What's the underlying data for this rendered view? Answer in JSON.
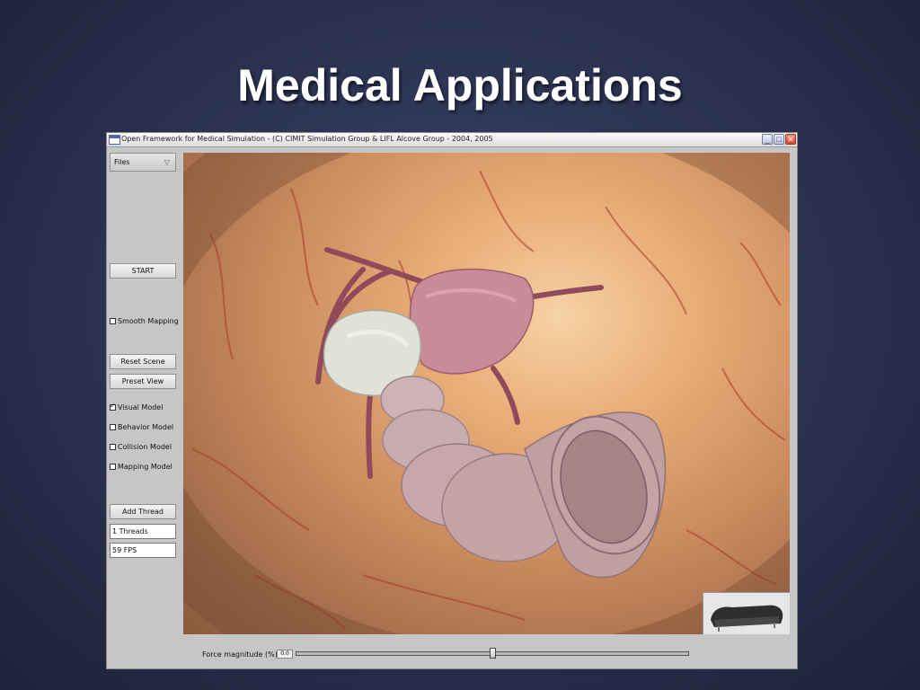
{
  "slide": {
    "title": "Medical Applications"
  },
  "window": {
    "title": "Open Framework for Medical Simulation - (C) CIMIT Simulation Group & LIFL Alcove Group - 2004, 2005",
    "controls": {
      "minimize": "_",
      "maximize": "□",
      "close": "✕"
    }
  },
  "sidebar": {
    "files_label": "Files",
    "start_label": "START",
    "smooth_mapping_label": "Smooth Mapping",
    "smooth_mapping_checked": false,
    "reset_scene_label": "Reset Scene",
    "preset_view_label": "Preset View",
    "visual_model_label": "Visual Model",
    "visual_model_checked": true,
    "behavior_model_label": "Behavior Model",
    "behavior_model_checked": false,
    "collision_model_label": "Collision Model",
    "collision_model_checked": false,
    "mapping_model_label": "Mapping Model",
    "mapping_model_checked": false,
    "add_thread_label": "Add Thread",
    "threads_value": "1 Threads",
    "fps_value": "59 FPS"
  },
  "bottom": {
    "force_label": "Force magnitude (%)",
    "force_value": "0.0",
    "slider_fraction": 0.5
  },
  "icons": {
    "app": "window-app-icon",
    "files_dropdown": "chevron-down-icon"
  },
  "colors": {
    "background": "#2a3150",
    "window_chrome": "#c6c6c6",
    "tissue_wall": "#e9ad78",
    "organ_pink": "#c98a9a",
    "close_button": "#d7442c"
  }
}
